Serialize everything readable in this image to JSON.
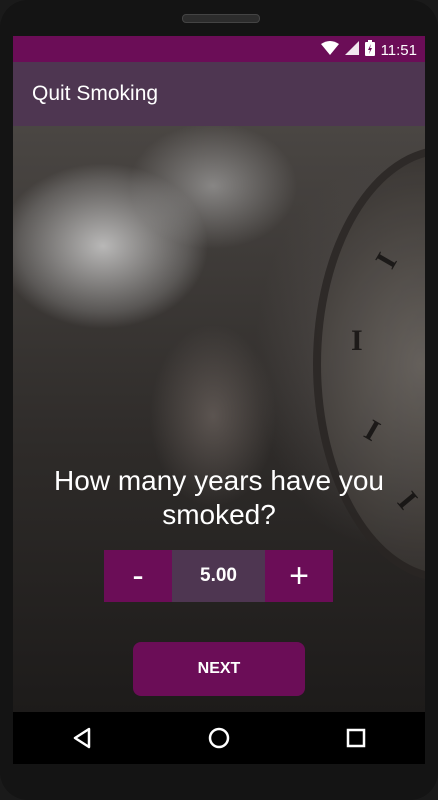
{
  "status_bar": {
    "time": "11:51",
    "icons": [
      "wifi-icon",
      "signal-icon",
      "battery-icon"
    ]
  },
  "app_bar": {
    "title": "Quit Smoking"
  },
  "background": {
    "description_icon": "smoke-woman-clock-photo",
    "clock_numerals": [
      "I",
      "I",
      "I",
      "I"
    ]
  },
  "question": {
    "text": "How many years have you smoked?"
  },
  "stepper": {
    "minus_label": "-",
    "value": "5.00",
    "plus_label": "+"
  },
  "next_button": {
    "label": "NEXT"
  },
  "nav_bar": {
    "items": [
      "back-icon",
      "home-icon",
      "recents-icon"
    ]
  },
  "colors": {
    "accent": "#6b0d57",
    "app_bar": "#4e3651",
    "status_bar": "#6b0d57"
  }
}
